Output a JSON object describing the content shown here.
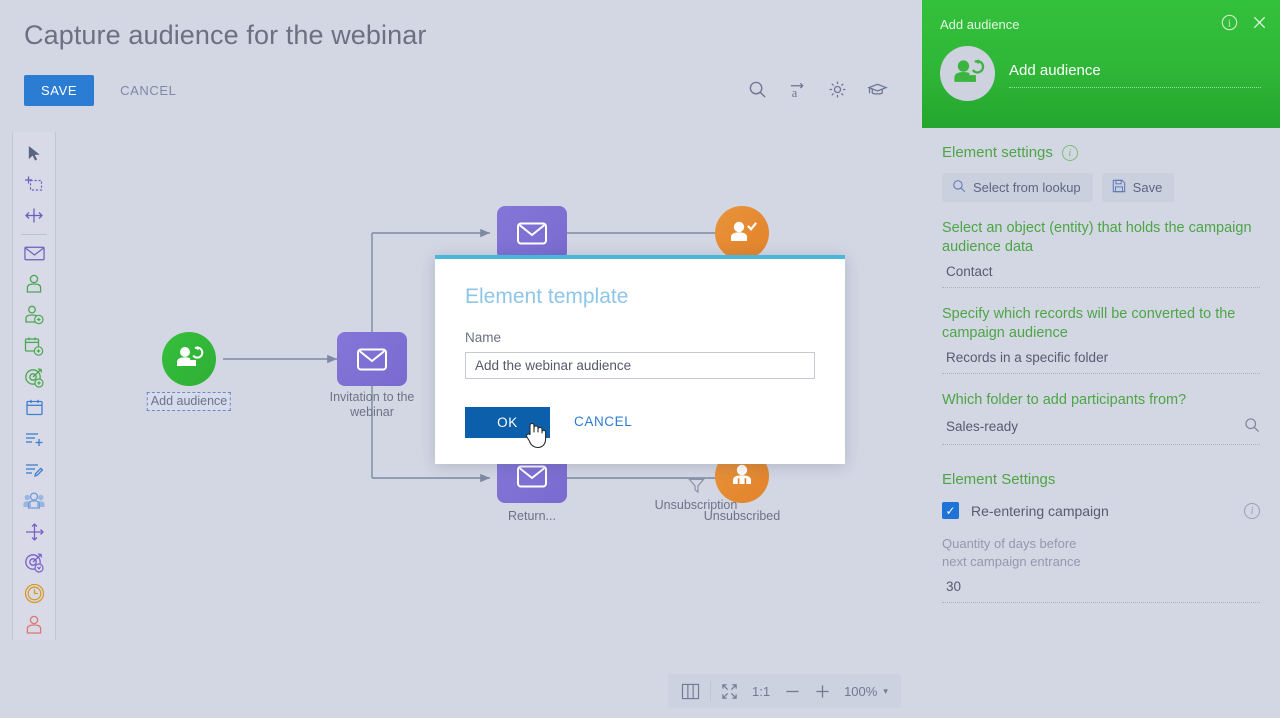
{
  "page": {
    "title": "Capture audience for the webinar",
    "save_label": "SAVE",
    "cancel_label": "CANCEL"
  },
  "top_tools": [
    {
      "name": "search-icon",
      "label": "Search"
    },
    {
      "name": "translate-icon",
      "label": "Translation"
    },
    {
      "name": "gear-icon",
      "label": "Settings"
    },
    {
      "name": "graduation-cap-icon",
      "label": "Learning"
    }
  ],
  "left_toolbar": [
    {
      "name": "pointer-tool",
      "label": "Select"
    },
    {
      "name": "marquee-select-tool",
      "label": "Area select"
    },
    {
      "name": "move-tool",
      "label": "Move"
    },
    {
      "name": "separator",
      "label": ""
    },
    {
      "name": "email-element",
      "label": "Email"
    },
    {
      "name": "audience-element",
      "label": "Audience"
    },
    {
      "name": "add-audience-element",
      "label": "Add audience"
    },
    {
      "name": "event-element",
      "label": "Event"
    },
    {
      "name": "goal-element",
      "label": "Goal"
    },
    {
      "name": "calendar-element",
      "label": "Calendar"
    },
    {
      "name": "add-task-element",
      "label": "Add task"
    },
    {
      "name": "edit-task-element",
      "label": "Edit task"
    },
    {
      "name": "group-audience-element",
      "label": "Group audience"
    },
    {
      "name": "split-flow-element",
      "label": "Split flow"
    },
    {
      "name": "campaign-goal-element",
      "label": "Campaign goal"
    },
    {
      "name": "timer-element",
      "label": "Timer"
    },
    {
      "name": "exit-element",
      "label": "Exit"
    }
  ],
  "diagram": {
    "nodes": [
      {
        "id": "add-audience",
        "shape": "circle",
        "color": "green",
        "icon": "add-audience-icon",
        "label": "Add audience",
        "selected": true
      },
      {
        "id": "invitation",
        "shape": "square",
        "color": "purple",
        "icon": "email-icon",
        "label": "Invitation to the webinar",
        "selected": false
      },
      {
        "id": "email-top",
        "shape": "square",
        "color": "purple",
        "icon": "email-icon",
        "label": "",
        "selected": false
      },
      {
        "id": "registered",
        "shape": "circle",
        "color": "orange",
        "icon": "user-check-icon",
        "label": "",
        "selected": false
      },
      {
        "id": "return",
        "shape": "square",
        "color": "purple",
        "icon": "email-icon",
        "label": "Return...",
        "selected": false
      },
      {
        "id": "unsubscribed",
        "shape": "circle",
        "color": "orange",
        "icon": "audience-icon",
        "label": "Unsubscribed",
        "selected": false
      }
    ],
    "filters": [
      {
        "id": "unsubscription-filter",
        "icon": "funnel-icon",
        "label": "Unsubscription"
      }
    ]
  },
  "zoom_bar": {
    "panels_label": "panels-icon",
    "fit_label": "fit-to-screen-icon",
    "actual_size_label": "1:1",
    "zoom_out_label": "—",
    "zoom_in_label": "+",
    "zoom_level": "100%",
    "chevron": "▾"
  },
  "modal": {
    "title": "Element template",
    "field_label": "Name",
    "field_value": "Add the webinar audience",
    "field_placeholder": "Add the webinar audience",
    "ok_label": "OK",
    "cancel_label": "CANCEL"
  },
  "panel": {
    "header_title": "Add audience",
    "entity_name": "Add audience",
    "avatar_icon": "add-audience-icon",
    "info_icon": "info-icon",
    "close_icon": "close-icon",
    "element_settings_title": "Element settings",
    "lookup_button": "Select from lookup",
    "save_button": "Save",
    "fields": [
      {
        "label": "Select an object (entity) that holds the campaign audience data",
        "value": "Contact",
        "has_search": false
      },
      {
        "label": "Specify which records will be converted to the campaign audience",
        "value": "Records in a specific folder",
        "has_search": false
      },
      {
        "label": "Which folder to add participants from?",
        "value": "Sales-ready",
        "has_search": true
      }
    ],
    "settings_title": "Element Settings",
    "checkbox_label": "Re-entering campaign",
    "checkbox_checked": true,
    "days_label_line1": "Quantity of days before",
    "days_label_line2": "next campaign entrance",
    "days_value": "30"
  },
  "colors": {
    "accent_blue": "#2b7cd3",
    "panel_green": "#2fb637",
    "node_purple": "#7a6ad0",
    "node_orange": "#e2822a",
    "node_green": "#2faf35",
    "modal_top": "#49b8d8",
    "background": "#d3d7e4"
  }
}
